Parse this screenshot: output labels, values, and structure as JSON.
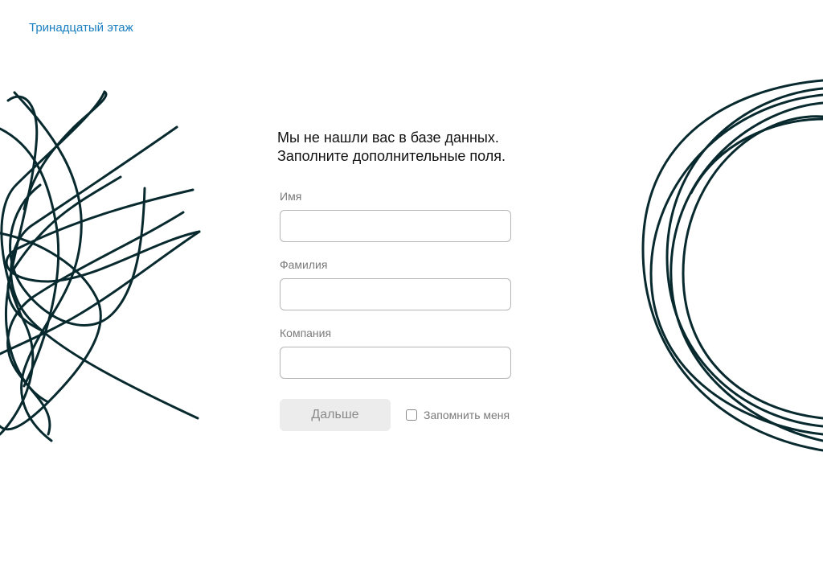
{
  "brand": {
    "name": "Тринадцатый этаж",
    "color": "#1a7fc0"
  },
  "form": {
    "heading_line1": "Мы не нашли вас в базе данных.",
    "heading_line2": "Заполните дополнительные поля.",
    "fields": [
      {
        "label": "Имя",
        "value": "",
        "placeholder": ""
      },
      {
        "label": "Фамилия",
        "value": "",
        "placeholder": ""
      },
      {
        "label": "Компания",
        "value": "",
        "placeholder": ""
      }
    ],
    "submit_label": "Дальше",
    "remember_label": "Запомнить меня",
    "remember_checked": false
  },
  "decor": {
    "left": "scribble-icon",
    "right": "circles-scribble-icon",
    "stroke_color": "#082a2e"
  }
}
